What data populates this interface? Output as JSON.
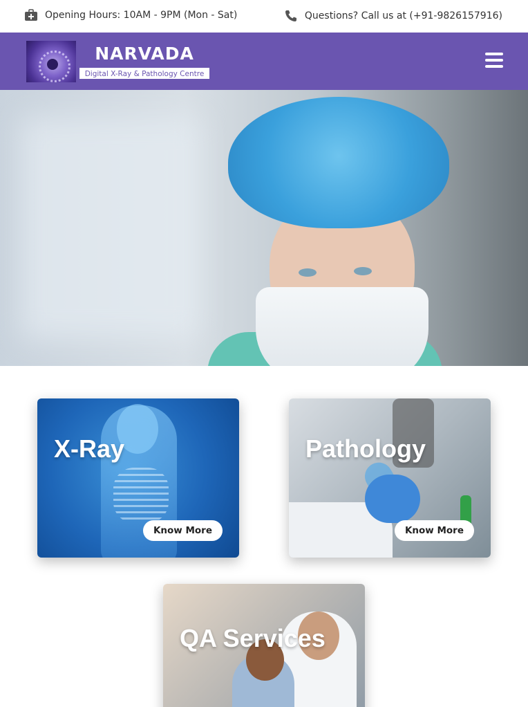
{
  "topbar": {
    "hours_icon": "medical-kit-icon",
    "hours_text": "Opening Hours: 10AM - 9PM (Mon - Sat)",
    "phone_icon": "phone-icon",
    "phone_text": "Questions? Call us at (+91-9826157916)"
  },
  "header": {
    "logo_name": "NARVADA",
    "logo_subtitle": "Digital X-Ray & Pathology Centre",
    "menu_icon": "hamburger-menu-icon",
    "brand_color": "#6a55b0"
  },
  "services": [
    {
      "title": "X-Ray",
      "button": "Know More"
    },
    {
      "title": "Pathology",
      "button": "Know More"
    },
    {
      "title": "QA Services"
    }
  ]
}
